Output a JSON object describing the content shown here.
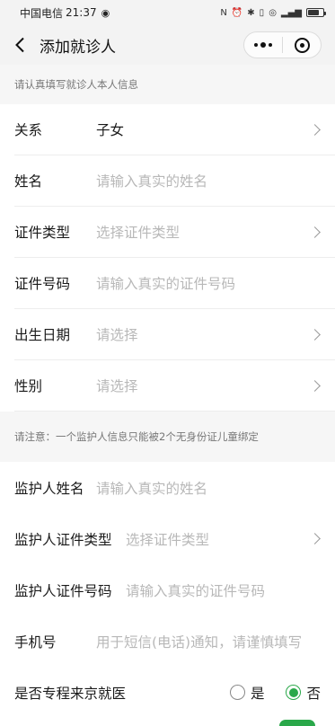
{
  "status_bar": {
    "carrier": "中国电信",
    "time": "21:37",
    "eye_icon": "eye-icon",
    "system_icons": "NFC ⏰ ✱ 📳 (4G) ⁴⁶ᴳ ▮",
    "battery_percent": 75
  },
  "navbar": {
    "back_icon": "chevron-left-icon",
    "title": "添加就诊人",
    "more_icon": "more-dots-icon",
    "close_icon": "miniprogram-close-icon"
  },
  "tip1": "请认真填写就诊人本人信息",
  "patient_fields": [
    {
      "label": "关系",
      "value": "子女",
      "is_placeholder": false,
      "has_arrow": true
    },
    {
      "label": "姓名",
      "value": "请输入真实的姓名",
      "is_placeholder": true,
      "has_arrow": false
    },
    {
      "label": "证件类型",
      "value": "选择证件类型",
      "is_placeholder": true,
      "has_arrow": true
    },
    {
      "label": "证件号码",
      "value": "请输入真实的证件号码",
      "is_placeholder": true,
      "has_arrow": false
    },
    {
      "label": "出生日期",
      "value": "请选择",
      "is_placeholder": true,
      "has_arrow": true
    },
    {
      "label": "性别",
      "value": "请选择",
      "is_placeholder": true,
      "has_arrow": true
    }
  ],
  "tip2": "请注意：一个监护人信息只能被2个无身份证儿童绑定",
  "guardian_fields": [
    {
      "label": "监护人姓名",
      "value": "请输入真实的姓名",
      "is_placeholder": true,
      "has_arrow": false
    },
    {
      "label": "监护人证件类型",
      "value": "选择证件类型",
      "is_placeholder": true,
      "has_arrow": true
    },
    {
      "label": "监护人证件号码",
      "value": "请输入真实的证件号码",
      "is_placeholder": true,
      "has_arrow": false
    },
    {
      "label": "手机号",
      "value": "用于短信(电话)通知，请谨慎填写",
      "is_placeholder": true,
      "has_arrow": false
    }
  ],
  "special_trip": {
    "label": "是否专程来京就医",
    "options": [
      "是",
      "否"
    ],
    "selected": "否"
  },
  "colors": {
    "accent_green": "#2aa84a",
    "placeholder_gray": "#b8b8b8",
    "section_bg": "#f6f6f6"
  }
}
